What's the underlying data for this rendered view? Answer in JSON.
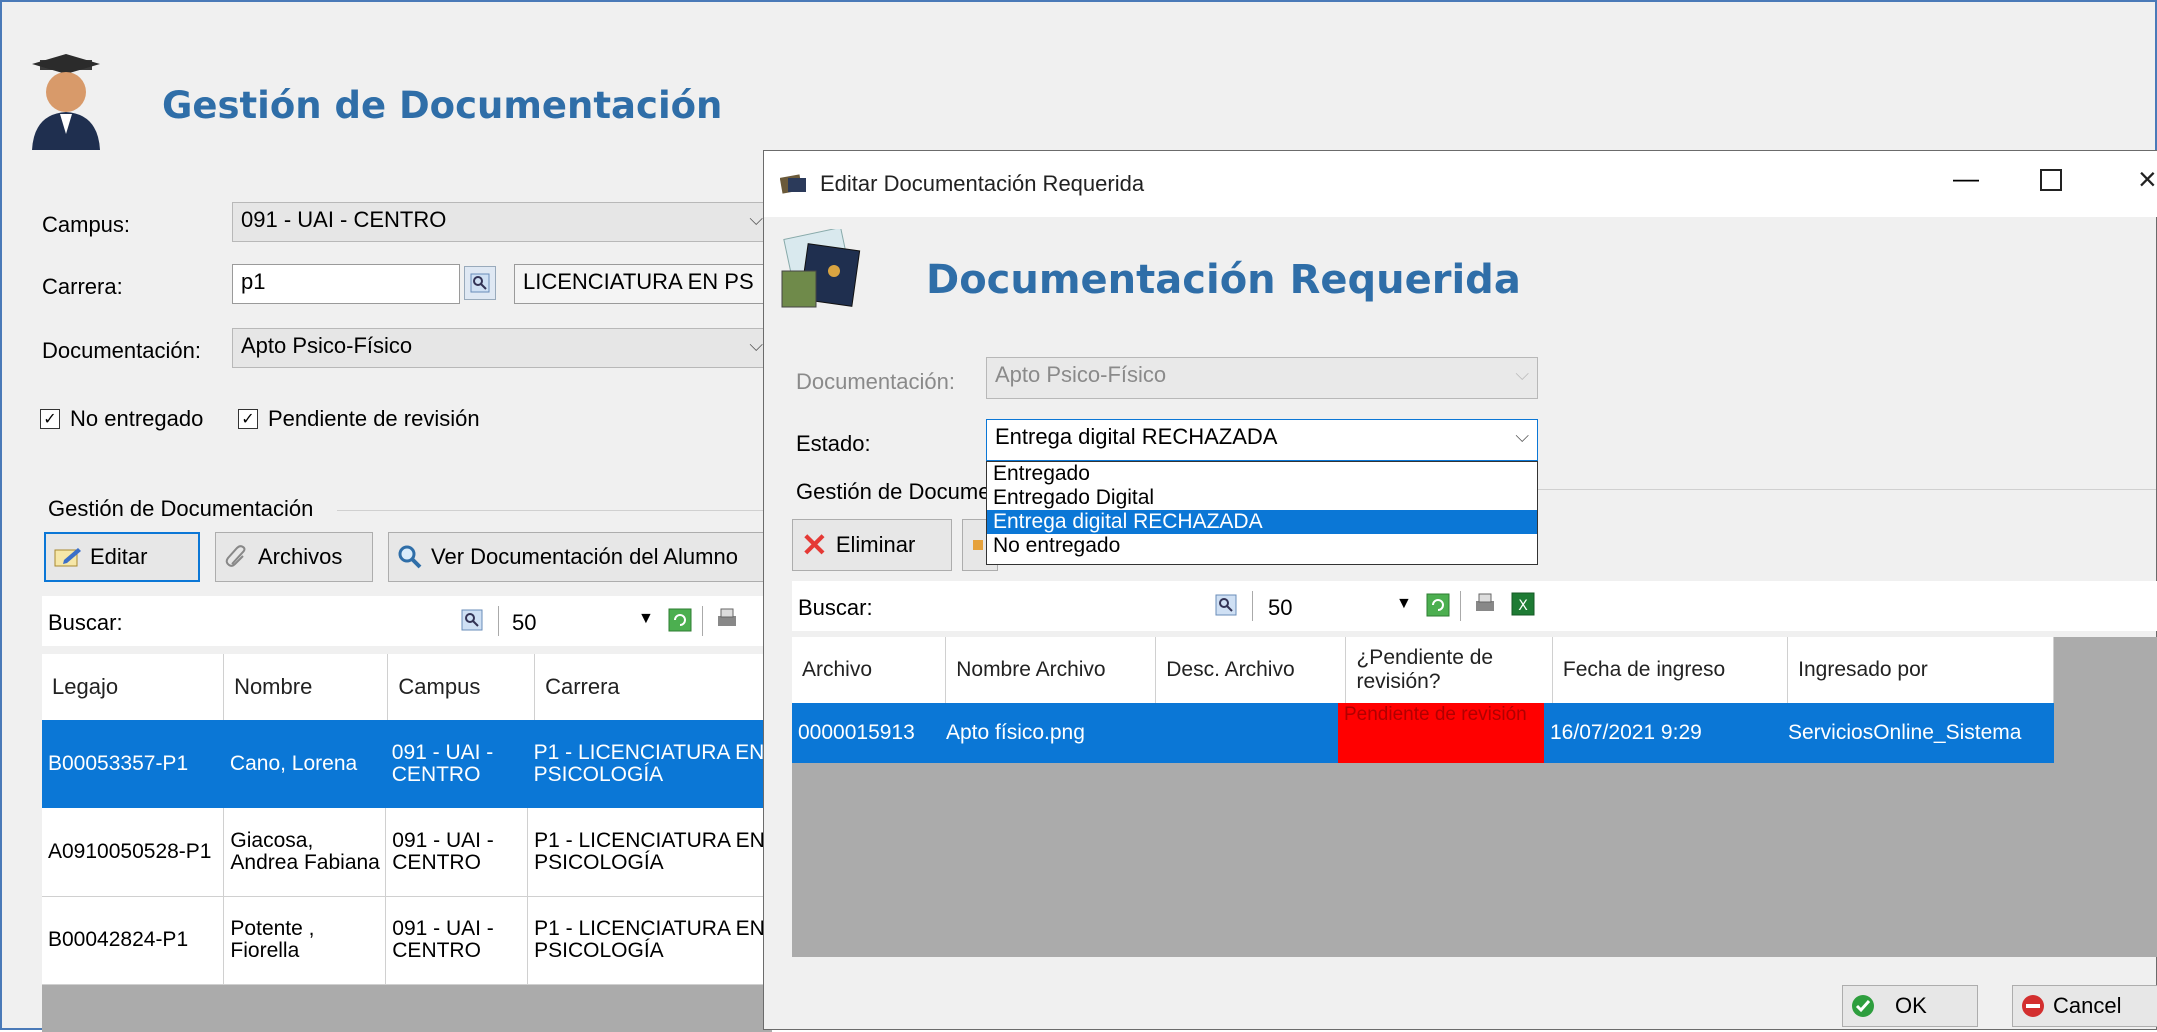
{
  "main": {
    "title": "Gestión de Documentación",
    "campus_label": "Campus:",
    "campus_value": "091 - UAI - CENTRO",
    "carrera_label": "Carrera:",
    "carrera_code": "p1",
    "carrera_name": "LICENCIATURA EN PS",
    "documentacion_label": "Documentación:",
    "documentacion_value": "Apto Psico-Físico",
    "chk_no_entregado": "No entregado",
    "chk_pendiente": "Pendiente de revisión",
    "group_label": "Gestión de Documentación",
    "btn_editar": "Editar",
    "btn_archivos": "Archivos",
    "btn_ver": "Ver Documentación del Alumno",
    "buscar_label": "Buscar:",
    "page_size": "50",
    "columns": [
      "Legajo",
      "Nombre",
      "Campus",
      "Carrera"
    ],
    "rows": [
      {
        "legajo": "B00053357-P1",
        "nombre": "Cano, Lorena",
        "campus": "091 - UAI - CENTRO",
        "carrera": "P1 - LICENCIATURA EN PSICOLOGÍA"
      },
      {
        "legajo": "A0910050528-P1",
        "nombre": "Giacosa, Andrea Fabiana",
        "campus": "091 - UAI - CENTRO",
        "carrera": "P1 - LICENCIATURA EN PSICOLOGÍA"
      },
      {
        "legajo": "B00042824-P1",
        "nombre": "Potente , Fiorella",
        "campus": "091 - UAI - CENTRO",
        "carrera": "P1 - LICENCIATURA EN PSICOLOGÍA"
      }
    ]
  },
  "dialog": {
    "window_title": "Editar Documentación Requerida",
    "title": "Documentación Requerida",
    "documentacion_label": "Documentación:",
    "documentacion_value": "Apto Psico-Físico",
    "estado_label": "Estado:",
    "estado_value": "Entrega digital RECHAZADA",
    "estado_options": [
      "Entregado",
      "Entregado Digital",
      "Entrega digital RECHAZADA",
      "No entregado"
    ],
    "group_label": "Gestión de Docume",
    "btn_eliminar": "Eliminar",
    "buscar_label": "Buscar:",
    "page_size": "50",
    "columns": [
      "Archivo",
      "Nombre Archivo",
      "Desc. Archivo",
      "¿Pendiente de revisión?",
      "Fecha de ingreso",
      "Ingresado por"
    ],
    "rows": [
      {
        "archivo": "0000015913",
        "nombre": "Apto físico.png",
        "desc": "",
        "pendiente": "Pendiente de revisión",
        "fecha": "16/07/2021 9:29",
        "ingresado": "ServiciosOnline_Sistema"
      }
    ],
    "btn_ok": "OK",
    "btn_cancel": "Cancel",
    "colors": {
      "selection": "#0b77d6",
      "pending": "#ff0000",
      "title": "#2f6ea8"
    }
  }
}
